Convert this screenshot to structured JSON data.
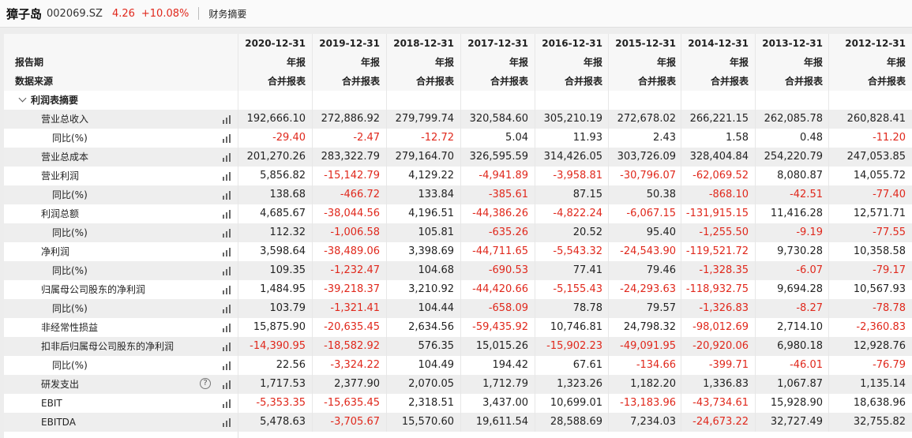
{
  "header": {
    "stock_name": "獐子岛",
    "stock_code": "002069.SZ",
    "price": "4.26",
    "change": "+10.08%",
    "tab": "财务摘要"
  },
  "table_head": {
    "row_labels": [
      "报告期",
      "数据来源"
    ],
    "periods": [
      "2020-12-31",
      "2019-12-31",
      "2018-12-31",
      "2017-12-31",
      "2016-12-31",
      "2015-12-31",
      "2014-12-31",
      "2013-12-31",
      "2012-12-31"
    ],
    "report_type": "年报",
    "data_source": "合并报表"
  },
  "section": {
    "label": "利润表摘要"
  },
  "rows": [
    {
      "label": "营业总收入",
      "level": 1,
      "values": [
        "192,666.10",
        "272,886.92",
        "279,799.74",
        "320,584.60",
        "305,210.19",
        "272,678.02",
        "266,221.15",
        "262,085.78",
        "260,828.41"
      ]
    },
    {
      "label": "同比(%)",
      "level": 2,
      "values": [
        "-29.40",
        "-2.47",
        "-12.72",
        "5.04",
        "11.93",
        "2.43",
        "1.58",
        "0.48",
        "-11.20"
      ]
    },
    {
      "label": "营业总成本",
      "level": 1,
      "values": [
        "201,270.26",
        "283,322.79",
        "279,164.70",
        "326,595.59",
        "314,426.05",
        "303,726.09",
        "328,404.84",
        "254,220.79",
        "247,053.85"
      ]
    },
    {
      "label": "营业利润",
      "level": 1,
      "values": [
        "5,856.82",
        "-15,142.79",
        "4,129.22",
        "-4,941.89",
        "-3,958.81",
        "-30,796.07",
        "-62,069.52",
        "8,080.87",
        "14,055.72"
      ]
    },
    {
      "label": "同比(%)",
      "level": 2,
      "values": [
        "138.68",
        "-466.72",
        "133.84",
        "-385.61",
        "87.15",
        "50.38",
        "-868.10",
        "-42.51",
        "-77.40"
      ]
    },
    {
      "label": "利润总额",
      "level": 1,
      "values": [
        "4,685.67",
        "-38,044.56",
        "4,196.51",
        "-44,386.26",
        "-4,822.24",
        "-6,067.15",
        "-131,915.15",
        "11,416.28",
        "12,571.71"
      ]
    },
    {
      "label": "同比(%)",
      "level": 2,
      "values": [
        "112.32",
        "-1,006.58",
        "105.81",
        "-635.26",
        "20.52",
        "95.40",
        "-1,255.50",
        "-9.19",
        "-77.55"
      ]
    },
    {
      "label": "净利润",
      "level": 1,
      "values": [
        "3,598.64",
        "-38,489.06",
        "3,398.69",
        "-44,711.65",
        "-5,543.32",
        "-24,543.90",
        "-119,521.72",
        "9,730.28",
        "10,358.58"
      ]
    },
    {
      "label": "同比(%)",
      "level": 2,
      "values": [
        "109.35",
        "-1,232.47",
        "104.68",
        "-690.53",
        "77.41",
        "79.46",
        "-1,328.35",
        "-6.07",
        "-79.17"
      ]
    },
    {
      "label": "归属母公司股东的净利润",
      "level": 1,
      "values": [
        "1,484.95",
        "-39,218.37",
        "3,210.92",
        "-44,420.66",
        "-5,155.43",
        "-24,293.63",
        "-118,932.75",
        "9,694.28",
        "10,567.93"
      ]
    },
    {
      "label": "同比(%)",
      "level": 2,
      "values": [
        "103.79",
        "-1,321.41",
        "104.44",
        "-658.09",
        "78.78",
        "79.57",
        "-1,326.83",
        "-8.27",
        "-78.78"
      ]
    },
    {
      "label": "非经常性损益",
      "level": 1,
      "values": [
        "15,875.90",
        "-20,635.45",
        "2,634.56",
        "-59,435.92",
        "10,746.81",
        "24,798.32",
        "-98,012.69",
        "2,714.10",
        "-2,360.83"
      ]
    },
    {
      "label": "扣非后归属母公司股东的净利润",
      "level": 1,
      "values": [
        "-14,390.95",
        "-18,582.92",
        "576.35",
        "15,015.26",
        "-15,902.23",
        "-49,091.95",
        "-20,920.06",
        "6,980.18",
        "12,928.76"
      ]
    },
    {
      "label": "同比(%)",
      "level": 2,
      "values": [
        "22.56",
        "-3,324.22",
        "104.49",
        "194.42",
        "67.61",
        "-134.66",
        "-399.71",
        "-46.01",
        "-76.79"
      ]
    },
    {
      "label": "研发支出",
      "level": 1,
      "help": "?",
      "values": [
        "1,717.53",
        "2,377.90",
        "2,070.05",
        "1,712.79",
        "1,323.26",
        "1,182.20",
        "1,336.83",
        "1,067.87",
        "1,135.14"
      ]
    },
    {
      "label": "EBIT",
      "level": 1,
      "values": [
        "-5,353.35",
        "-15,635.45",
        "2,318.51",
        "3,437.00",
        "10,699.01",
        "-13,183.96",
        "-43,734.61",
        "15,928.90",
        "18,638.96"
      ]
    },
    {
      "label": "EBITDA",
      "level": 1,
      "values": [
        "5,478.63",
        "-3,705.67",
        "15,570.60",
        "19,611.54",
        "28,588.69",
        "7,234.03",
        "-24,673.22",
        "32,727.49",
        "32,755.82"
      ]
    }
  ],
  "icons": {
    "chart": "bar-chart-icon",
    "help": "help-icon",
    "collapse": "chevron-down-icon"
  },
  "colors": {
    "negative": "#e0281c",
    "stripe": "#eeeeee",
    "header_bg": "#f7f7f7"
  }
}
